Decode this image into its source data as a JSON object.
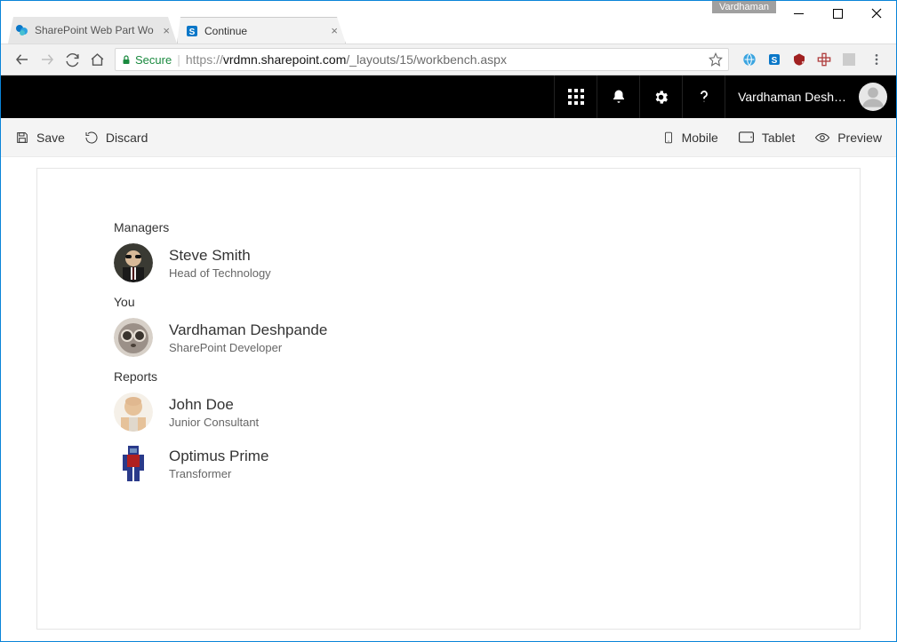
{
  "window": {
    "tag": "Vardhaman"
  },
  "tabs": [
    {
      "title": "SharePoint Web Part Wo",
      "active": false
    },
    {
      "title": "Continue",
      "active": true
    }
  ],
  "addressbar": {
    "secure_label": "Secure",
    "url_scheme": "https://",
    "url_host": "vrdmn.sharepoint.com",
    "url_path": "/_layouts/15/workbench.aspx"
  },
  "suite": {
    "user_display": "Vardhaman Desh…"
  },
  "commands": {
    "save": "Save",
    "discard": "Discard",
    "mobile": "Mobile",
    "tablet": "Tablet",
    "preview": "Preview"
  },
  "webpart": {
    "sections": [
      {
        "title": "Managers",
        "people": [
          {
            "name": "Steve Smith",
            "role": "Head of Technology",
            "avatar": "man-suit"
          }
        ]
      },
      {
        "title": "You",
        "people": [
          {
            "name": "Vardhaman Deshpande",
            "role": "SharePoint Developer",
            "avatar": "goggles-cat"
          }
        ]
      },
      {
        "title": "Reports",
        "people": [
          {
            "name": "John Doe",
            "role": "Junior Consultant",
            "avatar": "bald-man"
          },
          {
            "name": "Optimus Prime",
            "role": "Transformer",
            "avatar": "robot"
          }
        ]
      }
    ]
  }
}
